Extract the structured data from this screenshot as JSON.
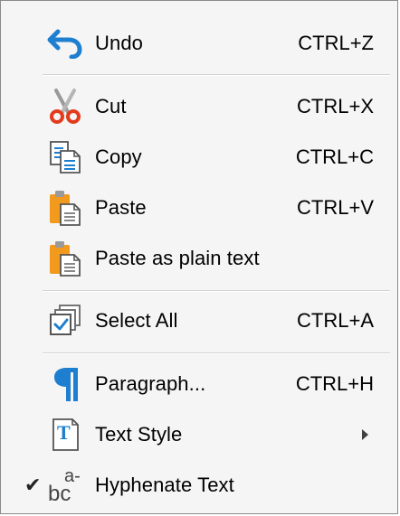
{
  "menu": {
    "undo": {
      "label": "Undo",
      "shortcut": "CTRL+Z",
      "icon": "undo-arrow-icon"
    },
    "cut": {
      "label": "Cut",
      "shortcut": "CTRL+X",
      "icon": "scissors-icon"
    },
    "copy": {
      "label": "Copy",
      "shortcut": "CTRL+C",
      "icon": "copy-pages-icon"
    },
    "paste": {
      "label": "Paste",
      "shortcut": "CTRL+V",
      "icon": "clipboard-icon"
    },
    "paste_plain": {
      "label": "Paste as plain text",
      "icon": "clipboard-plain-icon"
    },
    "select_all": {
      "label": "Select All",
      "shortcut": "CTRL+A",
      "icon": "select-all-icon"
    },
    "paragraph": {
      "label": "Paragraph...",
      "shortcut": "CTRL+H",
      "icon": "pilcrow-icon"
    },
    "text_style": {
      "label": "Text Style",
      "icon": "text-style-icon",
      "icon_text": "T",
      "has_submenu": true
    },
    "hyphenate": {
      "label": "Hyphenate Text",
      "icon": "hyphenate-icon",
      "checked": true,
      "check_mark": "✔",
      "icon_top": "a-",
      "icon_bottom": "bc"
    }
  },
  "colors": {
    "accent_blue": "#1e7fd0",
    "orange": "#f29a1e",
    "scissors_red": "#e23b1e"
  }
}
